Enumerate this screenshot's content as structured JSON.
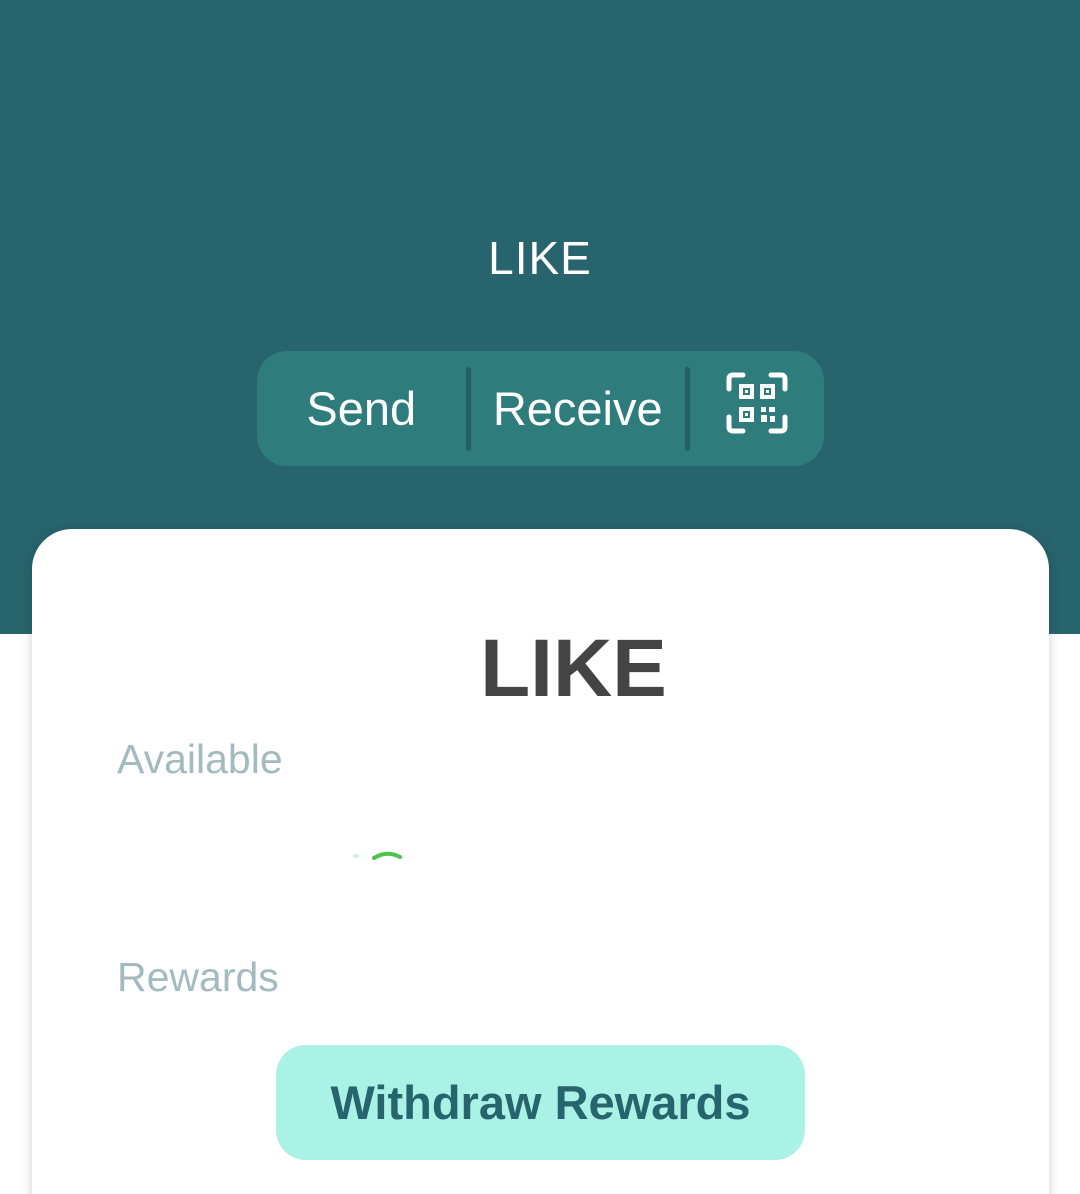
{
  "header": {
    "title": "LIKE",
    "background_color": "#28646E"
  },
  "actions": {
    "send_label": "Send",
    "receive_label": "Receive",
    "scan_icon": "qr-scan-icon",
    "bar_color": "#2F7C7C"
  },
  "card": {
    "title": "LIKE",
    "available_label": "Available",
    "rewards_label": "Rewards",
    "loading_indicator_color": "#4CC44A",
    "withdraw_label": "Withdraw Rewards",
    "withdraw_color": "#AAF1E6",
    "withdraw_text_color": "#28646E"
  }
}
